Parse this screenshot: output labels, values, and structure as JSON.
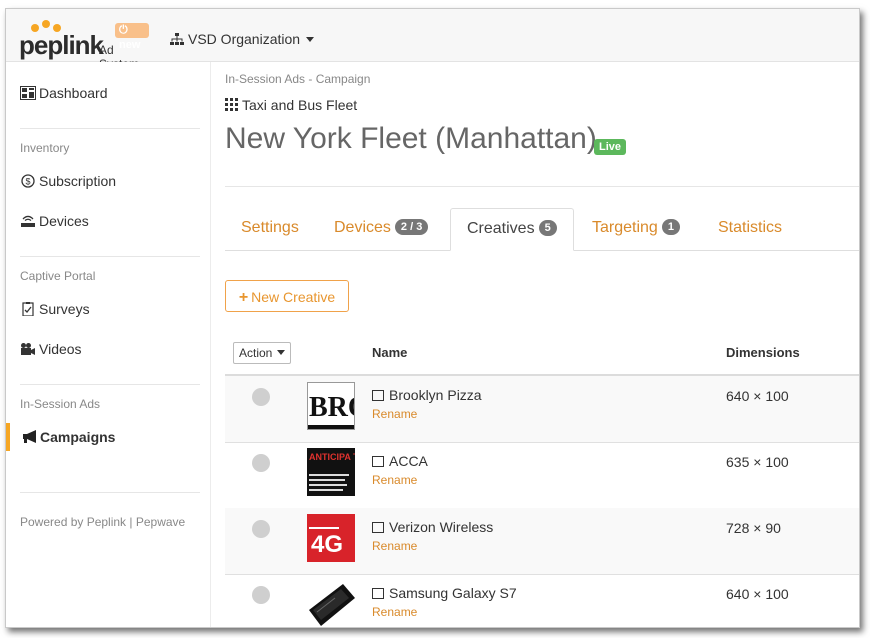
{
  "brand": {
    "logo_text": "peplink",
    "product": "Ad System",
    "badge": "new"
  },
  "org": {
    "label": "VSD Organization"
  },
  "sidebar": {
    "dashboard": "Dashboard",
    "section_inventory": "Inventory",
    "subscription": "Subscription",
    "devices": "Devices",
    "section_captive": "Captive Portal",
    "surveys": "Surveys",
    "videos": "Videos",
    "section_insession": "In-Session Ads",
    "campaigns": "Campaigns",
    "footer": "Powered by Peplink | Pepwave"
  },
  "main": {
    "breadcrumb": "In-Session Ads - Campaign",
    "group": "Taxi and Bus Fleet",
    "title": "New York Fleet (Manhattan)",
    "status": "Live",
    "tabs": [
      {
        "label": "Settings",
        "count": ""
      },
      {
        "label": "Devices",
        "count": "2 / 3"
      },
      {
        "label": "Creatives",
        "count": "5"
      },
      {
        "label": "Targeting",
        "count": "1"
      },
      {
        "label": "Statistics",
        "count": ""
      }
    ],
    "new_button": "New Creative",
    "table": {
      "action_label": "Action",
      "col_name": "Name",
      "col_dimensions": "Dimensions",
      "rows": [
        {
          "name": "Brooklyn Pizza",
          "rename": "Rename",
          "dimensions": "640 × 100",
          "thumb_text": "BRO"
        },
        {
          "name": "ACCA",
          "rename": "Rename",
          "dimensions": "635 × 100",
          "thumb_text": "ANTICIPA THE FUT"
        },
        {
          "name": "Verizon Wireless",
          "rename": "Rename",
          "dimensions": "728 × 90",
          "thumb_text": "4G"
        },
        {
          "name": "Samsung Galaxy S7",
          "rename": "Rename",
          "dimensions": "640 × 100",
          "thumb_text": ""
        }
      ]
    }
  },
  "colors": {
    "accent": "#f6a623",
    "link": "#d98a2b",
    "live": "#5cb85c",
    "badge": "#777777"
  }
}
